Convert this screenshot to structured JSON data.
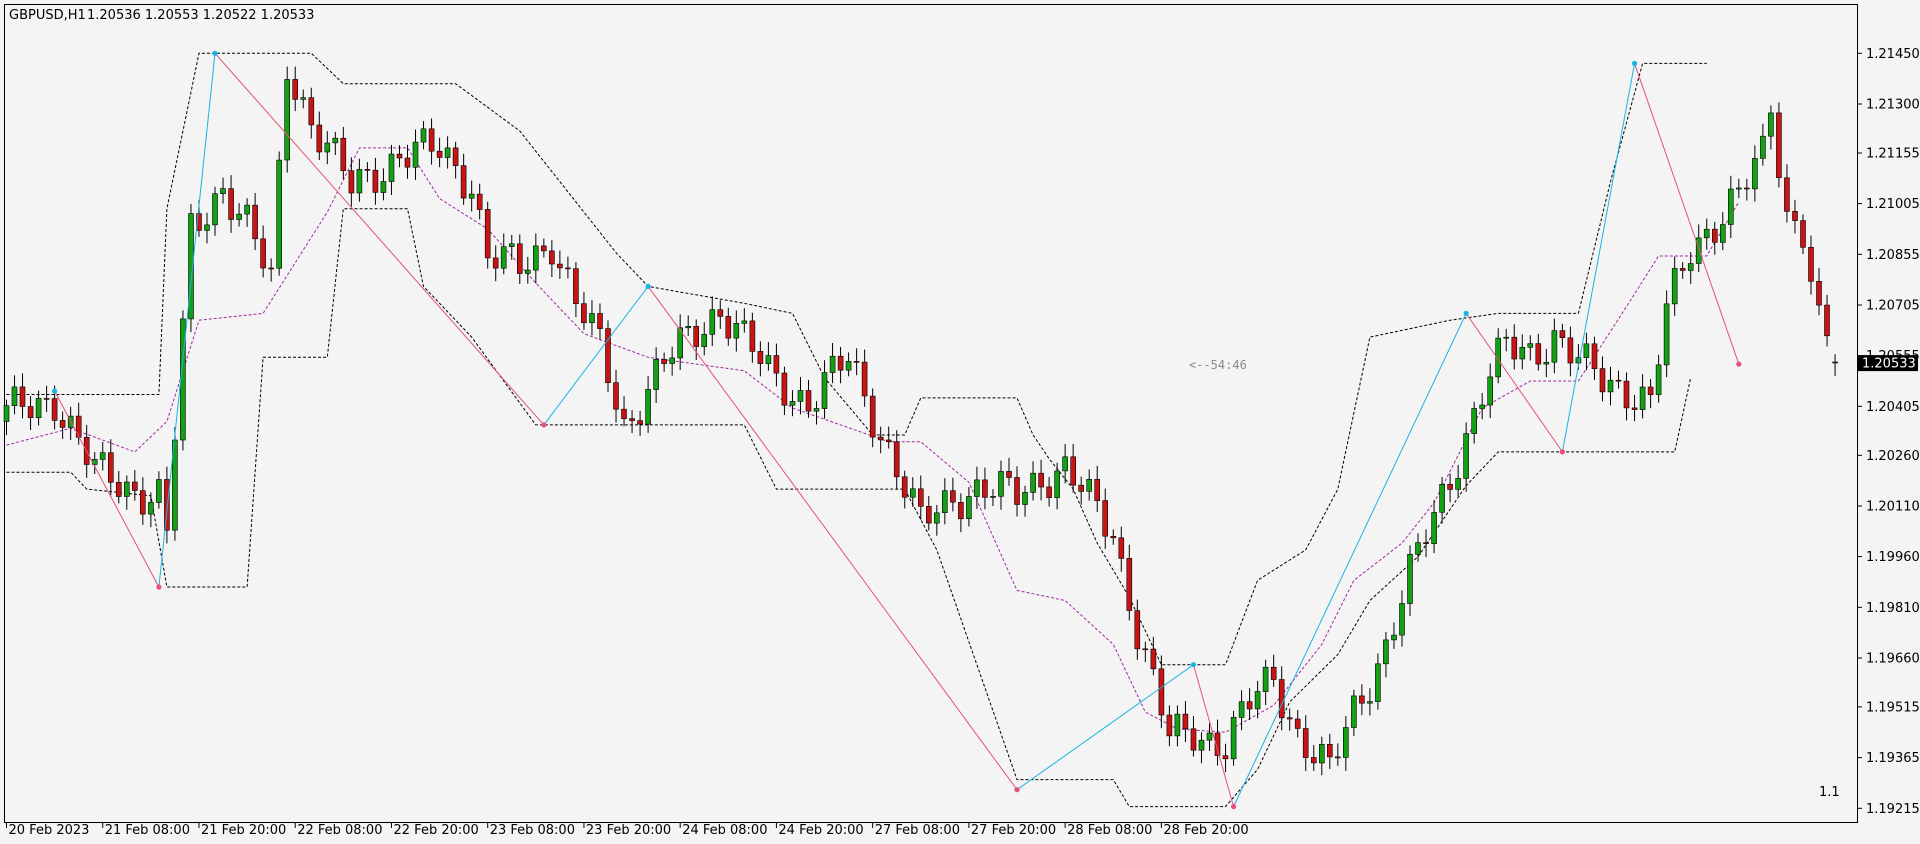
{
  "window": {
    "symbol_label": "GBPUSD,H1",
    "ohlc_values": "1.20536 1.20553 1.20522 1.20533"
  },
  "chart_data": {
    "type": "candlestick",
    "symbol": "GBPUSD",
    "timeframe": "H1",
    "ohlc": {
      "open": 1.20536,
      "high": 1.20553,
      "low": 1.20522,
      "close": 1.20533
    },
    "current_price_label": "1.20533",
    "current_price_value": 1.20533,
    "covered_tick_label": "1.20555",
    "timer_label": "<--54:46",
    "corner_label": "1.1",
    "ylim": [
      1.9157,
      1.2148
    ],
    "y_ticks": [
      "1.21450",
      "1.21300",
      "1.21155",
      "1.21005",
      "1.20855",
      "1.20705",
      "1.20405",
      "1.20260",
      "1.20110",
      "1.19960",
      "1.19810",
      "1.19660",
      "1.19515",
      "1.19365",
      "1.19215"
    ],
    "x_ticks": [
      "20 Feb 2023",
      "21 Feb 08:00",
      "21 Feb 20:00",
      "22 Feb 08:00",
      "22 Feb 20:00",
      "23 Feb 08:00",
      "23 Feb 20:00",
      "24 Feb 08:00",
      "24 Feb 20:00",
      "27 Feb 08:00",
      "27 Feb 20:00",
      "28 Feb 08:00",
      "28 Feb 20:00"
    ],
    "bars_per_label": 12,
    "grid": false,
    "colors": {
      "background": "#f4f4f4",
      "bull": "#14a014",
      "bear": "#c81414",
      "wick": "#000000",
      "zigzag_up": "#19b4e6",
      "zigzag_down": "#e6507a",
      "channel": "#000000",
      "midline": "#a028a0",
      "price_tag": "#000000",
      "price_tag_text": "#ffffff"
    },
    "series": [
      {
        "name": "candles",
        "anchors": [
          [
            0,
            1.2038
          ],
          [
            6,
            1.2043
          ],
          [
            11,
            1.2021
          ],
          [
            16,
            1.2016
          ],
          [
            19,
            1.2014
          ],
          [
            20,
            1.2002
          ],
          [
            23,
            1.2092
          ],
          [
            27,
            1.2106
          ],
          [
            30,
            1.2094
          ],
          [
            33,
            1.2077
          ],
          [
            35,
            1.2142
          ],
          [
            38,
            1.2125
          ],
          [
            43,
            1.2105
          ],
          [
            49,
            1.2115
          ],
          [
            54,
            1.2116
          ],
          [
            58,
            1.2107
          ],
          [
            60,
            1.2085
          ],
          [
            64,
            1.2081
          ],
          [
            68,
            1.209
          ],
          [
            71,
            1.2071
          ],
          [
            74,
            1.2058
          ],
          [
            77,
            1.2035
          ],
          [
            82,
            1.2053
          ],
          [
            89,
            1.207
          ],
          [
            92,
            1.206
          ],
          [
            95,
            1.205
          ],
          [
            100,
            1.2042
          ],
          [
            105,
            1.2054
          ],
          [
            110,
            1.2028
          ],
          [
            114,
            1.2005
          ],
          [
            118,
            1.2014
          ],
          [
            121,
            1.2016
          ],
          [
            126,
            1.2014
          ],
          [
            129,
            1.202
          ],
          [
            132,
            1.2022
          ],
          [
            135,
            1.2012
          ],
          [
            138,
            1.2003
          ],
          [
            141,
            1.1975
          ],
          [
            145,
            1.1942
          ],
          [
            148,
            1.1944
          ],
          [
            152,
            1.1941
          ],
          [
            155,
            1.1952
          ],
          [
            158,
            1.196
          ],
          [
            161,
            1.1944
          ],
          [
            165,
            1.1932
          ],
          [
            168,
            1.195
          ],
          [
            172,
            1.197
          ],
          [
            175,
            1.199
          ],
          [
            178,
            1.2008
          ],
          [
            181,
            1.2026
          ],
          [
            184,
            1.2044
          ],
          [
            187,
            1.2058
          ],
          [
            190,
            1.2057
          ],
          [
            193,
            1.2061
          ],
          [
            196,
            1.2053
          ],
          [
            199,
            1.2049
          ],
          [
            202,
            1.2046
          ],
          [
            205,
            1.2041
          ],
          [
            207,
            1.2068
          ],
          [
            210,
            1.2088
          ],
          [
            213,
            1.2095
          ],
          [
            216,
            1.2102
          ],
          [
            219,
            1.2115
          ],
          [
            220,
            1.213
          ],
          [
            222,
            1.2098
          ],
          [
            224,
            1.2093
          ],
          [
            226,
            1.2064
          ],
          [
            228,
            1.2053
          ]
        ]
      },
      {
        "name": "zigzag",
        "points": [
          [
            6,
            1.2045
          ],
          [
            19,
            1.1987
          ],
          [
            26,
            1.2145
          ],
          [
            67,
            1.2035
          ],
          [
            80,
            1.2076
          ],
          [
            126,
            1.1927
          ],
          [
            148,
            1.1964
          ],
          [
            153,
            1.1922
          ],
          [
            182,
            1.2068
          ],
          [
            194,
            1.2027
          ],
          [
            203,
            1.2142
          ],
          [
            216,
            1.2053
          ]
        ]
      },
      {
        "name": "channel_upper",
        "points": [
          [
            0,
            1.2044
          ],
          [
            6,
            1.2044
          ],
          [
            8,
            1.2044
          ],
          [
            19,
            1.2044
          ],
          [
            20,
            1.2099
          ],
          [
            24,
            1.2145
          ],
          [
            38,
            1.2145
          ],
          [
            42,
            1.2136
          ],
          [
            56,
            1.2136
          ],
          [
            60,
            1.2129
          ],
          [
            64,
            1.2122
          ],
          [
            76,
            1.2086
          ],
          [
            80,
            1.2076
          ],
          [
            92,
            1.2071
          ],
          [
            98,
            1.2068
          ],
          [
            102,
            1.2049
          ],
          [
            108,
            1.2032
          ],
          [
            112,
            1.2032
          ],
          [
            114,
            1.2043
          ],
          [
            126,
            1.2043
          ],
          [
            128,
            1.2032
          ],
          [
            130,
            1.2025
          ],
          [
            133,
            1.2016
          ],
          [
            136,
            1.2
          ],
          [
            140,
            1.1984
          ],
          [
            144,
            1.1964
          ],
          [
            152,
            1.1964
          ],
          [
            156,
            1.1989
          ],
          [
            162,
            1.1998
          ],
          [
            166,
            1.2016
          ],
          [
            170,
            1.2061
          ],
          [
            180,
            1.2066
          ],
          [
            186,
            1.2068
          ],
          [
            196,
            1.2068
          ],
          [
            200,
            1.2107
          ],
          [
            204,
            1.2142
          ],
          [
            212,
            1.2142
          ]
        ]
      },
      {
        "name": "channel_lower",
        "points": [
          [
            0,
            1.2021
          ],
          [
            8,
            1.2021
          ],
          [
            10,
            1.2016
          ],
          [
            18,
            1.2014
          ],
          [
            20,
            1.1987
          ],
          [
            30,
            1.1987
          ],
          [
            32,
            1.2055
          ],
          [
            40,
            1.2055
          ],
          [
            42,
            1.2099
          ],
          [
            50,
            1.2099
          ],
          [
            52,
            1.2076
          ],
          [
            58,
            1.2061
          ],
          [
            66,
            1.2035
          ],
          [
            80,
            1.2035
          ],
          [
            92,
            1.2035
          ],
          [
            96,
            1.2016
          ],
          [
            112,
            1.2016
          ],
          [
            116,
            1.1998
          ],
          [
            126,
            1.193
          ],
          [
            138,
            1.193
          ],
          [
            140,
            1.1922
          ],
          [
            152,
            1.1922
          ],
          [
            156,
            1.1933
          ],
          [
            160,
            1.1953
          ],
          [
            166,
            1.1967
          ],
          [
            170,
            1.1983
          ],
          [
            176,
            1.1996
          ],
          [
            182,
            1.2017
          ],
          [
            186,
            1.2027
          ],
          [
            208,
            1.2027
          ],
          [
            210,
            1.2049
          ]
        ]
      },
      {
        "name": "channel_midline",
        "points": [
          [
            0,
            1.2029
          ],
          [
            8,
            1.2034
          ],
          [
            16,
            1.2027
          ],
          [
            20,
            1.2036
          ],
          [
            24,
            1.2066
          ],
          [
            32,
            1.2068
          ],
          [
            40,
            1.2098
          ],
          [
            44,
            1.2117
          ],
          [
            50,
            1.2117
          ],
          [
            54,
            1.2102
          ],
          [
            60,
            1.2093
          ],
          [
            66,
            1.2077
          ],
          [
            72,
            1.2062
          ],
          [
            80,
            1.2055
          ],
          [
            86,
            1.2053
          ],
          [
            92,
            1.2051
          ],
          [
            98,
            1.204
          ],
          [
            110,
            1.203
          ],
          [
            114,
            1.203
          ],
          [
            120,
            1.2018
          ],
          [
            126,
            1.1986
          ],
          [
            132,
            1.1983
          ],
          [
            138,
            1.197
          ],
          [
            142,
            1.195
          ],
          [
            146,
            1.1945
          ],
          [
            152,
            1.1944
          ],
          [
            158,
            1.1952
          ],
          [
            164,
            1.197
          ],
          [
            168,
            1.1989
          ],
          [
            174,
            1.2
          ],
          [
            178,
            1.2012
          ],
          [
            184,
            1.204
          ],
          [
            190,
            1.2048
          ],
          [
            196,
            1.2048
          ],
          [
            202,
            1.207
          ],
          [
            206,
            1.2085
          ],
          [
            212,
            1.2085
          ],
          [
            216,
            1.2101
          ]
        ]
      }
    ]
  }
}
